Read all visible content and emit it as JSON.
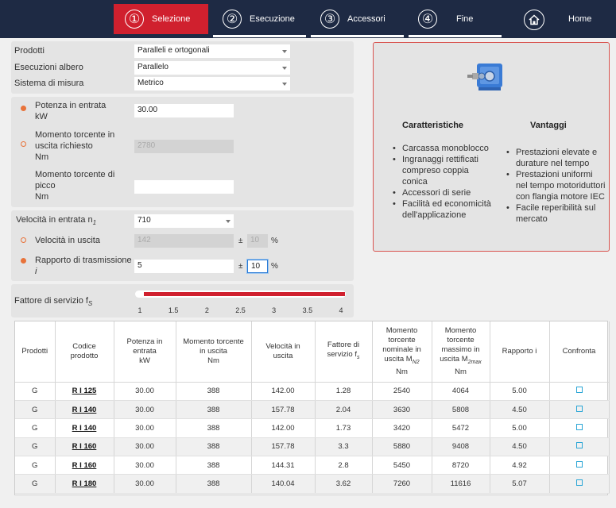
{
  "nav": {
    "steps": [
      {
        "num": "①",
        "label": "Selezione"
      },
      {
        "num": "②",
        "label": "Esecuzione"
      },
      {
        "num": "③",
        "label": "Accessori"
      },
      {
        "num": "④",
        "label": "Fine"
      }
    ],
    "home_label": "Home"
  },
  "form": {
    "prodotti_label": "Prodotti",
    "prodotti_value": "Paralleli e ortogonali",
    "esecuzioni_label": "Esecuzioni albero",
    "esecuzioni_value": "Parallelo",
    "sistema_label": "Sistema di misura",
    "sistema_value": "Metrico",
    "potenza_label_1": "Potenza in entrata",
    "potenza_label_2": "kW",
    "potenza_value": "30.00",
    "momento_label_1": "Momento torcente in",
    "momento_label_2": "uscita richiesto",
    "momento_label_3": "Nm",
    "momento_value": "2780",
    "picco_label_1": "Momento torcente di",
    "picco_label_2": "picco",
    "picco_label_3": "Nm",
    "picco_value": "",
    "velocita_entrata_label": "Velocità in entrata n",
    "velocita_entrata_sub": "1",
    "velocita_entrata_value": "710",
    "velocita_uscita_label": "Velocità in uscita",
    "velocita_uscita_value": "142",
    "velocita_uscita_tol": "10",
    "rapporto_label_1": "Rapporto di trasmissione",
    "rapporto_label_2": "i",
    "rapporto_value": "5",
    "rapporto_tol": "10",
    "plusminus": "±",
    "percent": "%",
    "fattore_label": "Fattore di servizio f",
    "fattore_sub": "S",
    "slider_ticks": [
      "1",
      "1.5",
      "2",
      "2.5",
      "3",
      "3.5",
      "4"
    ],
    "slider_range": [
      1,
      4
    ]
  },
  "info": {
    "caratteristiche_title": "Caratteristiche",
    "caratteristiche": [
      "Carcassa monoblocco",
      "Ingranaggi rettificati compreso coppia conica",
      "Accessori di serie",
      "Facilità ed economicità dell'applicazione"
    ],
    "vantaggi_title": "Vantaggi",
    "vantaggi": [
      "Prestazioni elevate e durature nel tempo",
      "Prestazioni uniformi nel tempo motoriduttori con flangia motore IEC",
      "Facile reperibilità sul mercato"
    ]
  },
  "table": {
    "headers": {
      "prodotti": "Prodotti",
      "codice_1": "Codice",
      "codice_2": "prodotto",
      "potenza_1": "Potenza in",
      "potenza_2": "entrata",
      "potenza_3": "kW",
      "momento_1": "Momento torcente",
      "momento_2": "in uscita",
      "momento_3": "Nm",
      "velocita_1": "Velocità in",
      "velocita_2": "uscita",
      "fattore_1": "Fattore di",
      "fattore_2": "servizio f",
      "fattore_sub": "s",
      "mn2_1": "Momento",
      "mn2_2": "torcente",
      "mn2_3": "nominale in",
      "mn2_4": "uscita M",
      "mn2_sub": "N2",
      "mn2_5": "Nm",
      "m2max_1": "Momento",
      "m2max_2": "torcente",
      "m2max_3": "massimo in",
      "m2max_4": "uscita M",
      "m2max_sub": "2max",
      "m2max_5": "Nm",
      "rapporto": "Rapporto i",
      "confronta": "Confronta"
    },
    "rows": [
      {
        "prodotti": "G",
        "codice": "R I 125",
        "potenza": "30.00",
        "momento": "388",
        "velocita": "142.00",
        "fattore": "1.28",
        "mn2": "2540",
        "m2max": "4064",
        "rapporto": "5.00"
      },
      {
        "prodotti": "G",
        "codice": "R I 140",
        "potenza": "30.00",
        "momento": "388",
        "velocita": "157.78",
        "fattore": "2.04",
        "mn2": "3630",
        "m2max": "5808",
        "rapporto": "4.50"
      },
      {
        "prodotti": "G",
        "codice": "R I 140",
        "potenza": "30.00",
        "momento": "388",
        "velocita": "142.00",
        "fattore": "1.73",
        "mn2": "3420",
        "m2max": "5472",
        "rapporto": "5.00"
      },
      {
        "prodotti": "G",
        "codice": "R I 160",
        "potenza": "30.00",
        "momento": "388",
        "velocita": "157.78",
        "fattore": "3.3",
        "mn2": "5880",
        "m2max": "9408",
        "rapporto": "4.50"
      },
      {
        "prodotti": "G",
        "codice": "R I 160",
        "potenza": "30.00",
        "momento": "388",
        "velocita": "144.31",
        "fattore": "2.8",
        "mn2": "5450",
        "m2max": "8720",
        "rapporto": "4.92"
      },
      {
        "prodotti": "G",
        "codice": "R I 180",
        "potenza": "30.00",
        "momento": "388",
        "velocita": "140.04",
        "fattore": "3.62",
        "mn2": "7260",
        "m2max": "11616",
        "rapporto": "5.07"
      }
    ]
  }
}
